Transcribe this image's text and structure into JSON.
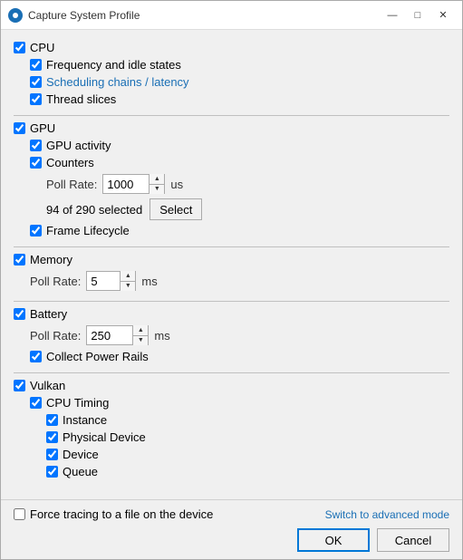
{
  "window": {
    "title": "Capture System Profile",
    "icon": "●"
  },
  "cpu": {
    "label": "CPU",
    "checked": true,
    "items": [
      {
        "id": "freq-idle",
        "label": "Frequency and idle states",
        "checked": true
      },
      {
        "id": "sched-chains",
        "label": "Scheduling chains / latency",
        "checked": true,
        "blue": true
      },
      {
        "id": "thread-slices",
        "label": "Thread slices",
        "checked": true
      }
    ]
  },
  "gpu": {
    "label": "GPU",
    "checked": true,
    "items": [
      {
        "id": "gpu-activity",
        "label": "GPU activity",
        "checked": true
      },
      {
        "id": "counters",
        "label": "Counters",
        "checked": true
      }
    ],
    "poll_rate": {
      "label": "Poll Rate:",
      "value": "1000",
      "unit": "us"
    },
    "select_info": {
      "text": "94 of 290 selected",
      "button_label": "Select"
    },
    "frame_lifecycle": {
      "label": "Frame Lifecycle",
      "checked": true
    }
  },
  "memory": {
    "label": "Memory",
    "checked": true,
    "poll_rate": {
      "label": "Poll Rate:",
      "value": "5",
      "unit": "ms"
    }
  },
  "battery": {
    "label": "Battery",
    "checked": true,
    "poll_rate": {
      "label": "Poll Rate:",
      "value": "250",
      "unit": "ms"
    },
    "collect_power_rails": {
      "label": "Collect Power Rails",
      "checked": true
    }
  },
  "vulkan": {
    "label": "Vulkan",
    "checked": true,
    "cpu_timing": {
      "label": "CPU Timing",
      "checked": true,
      "items": [
        {
          "id": "instance",
          "label": "Instance",
          "checked": true
        },
        {
          "id": "physical-device",
          "label": "Physical Device",
          "checked": true
        },
        {
          "id": "device",
          "label": "Device",
          "checked": true
        },
        {
          "id": "queue",
          "label": "Queue",
          "checked": true
        }
      ]
    }
  },
  "force_tracing": {
    "label": "Force tracing to a file on the device",
    "checked": false
  },
  "advanced_link": "Switch to advanced mode",
  "buttons": {
    "ok": "OK",
    "cancel": "Cancel"
  }
}
